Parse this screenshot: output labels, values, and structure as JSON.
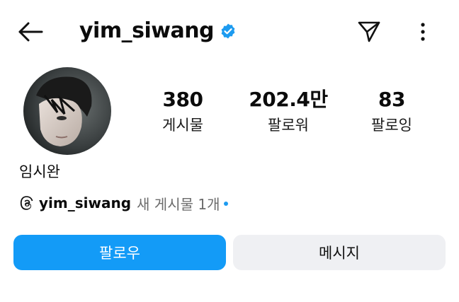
{
  "header": {
    "username": "yim_siwang",
    "verified_color": "#1d9bf0",
    "icons": [
      "back-arrow-icon",
      "verified-badge-icon",
      "send-icon",
      "more-vertical-icon"
    ]
  },
  "stats": {
    "posts": {
      "value": "380",
      "label": "게시물"
    },
    "followers": {
      "value": "202.4만",
      "label": "팔로워"
    },
    "following": {
      "value": "83",
      "label": "팔로잉"
    }
  },
  "profile": {
    "name": "임시완"
  },
  "threads": {
    "username": "yim_siwang",
    "new_posts": "새 게시물 1개"
  },
  "actions": {
    "follow_label": "팔로우",
    "message_label": "메시지",
    "accent_color": "#139bf7"
  }
}
